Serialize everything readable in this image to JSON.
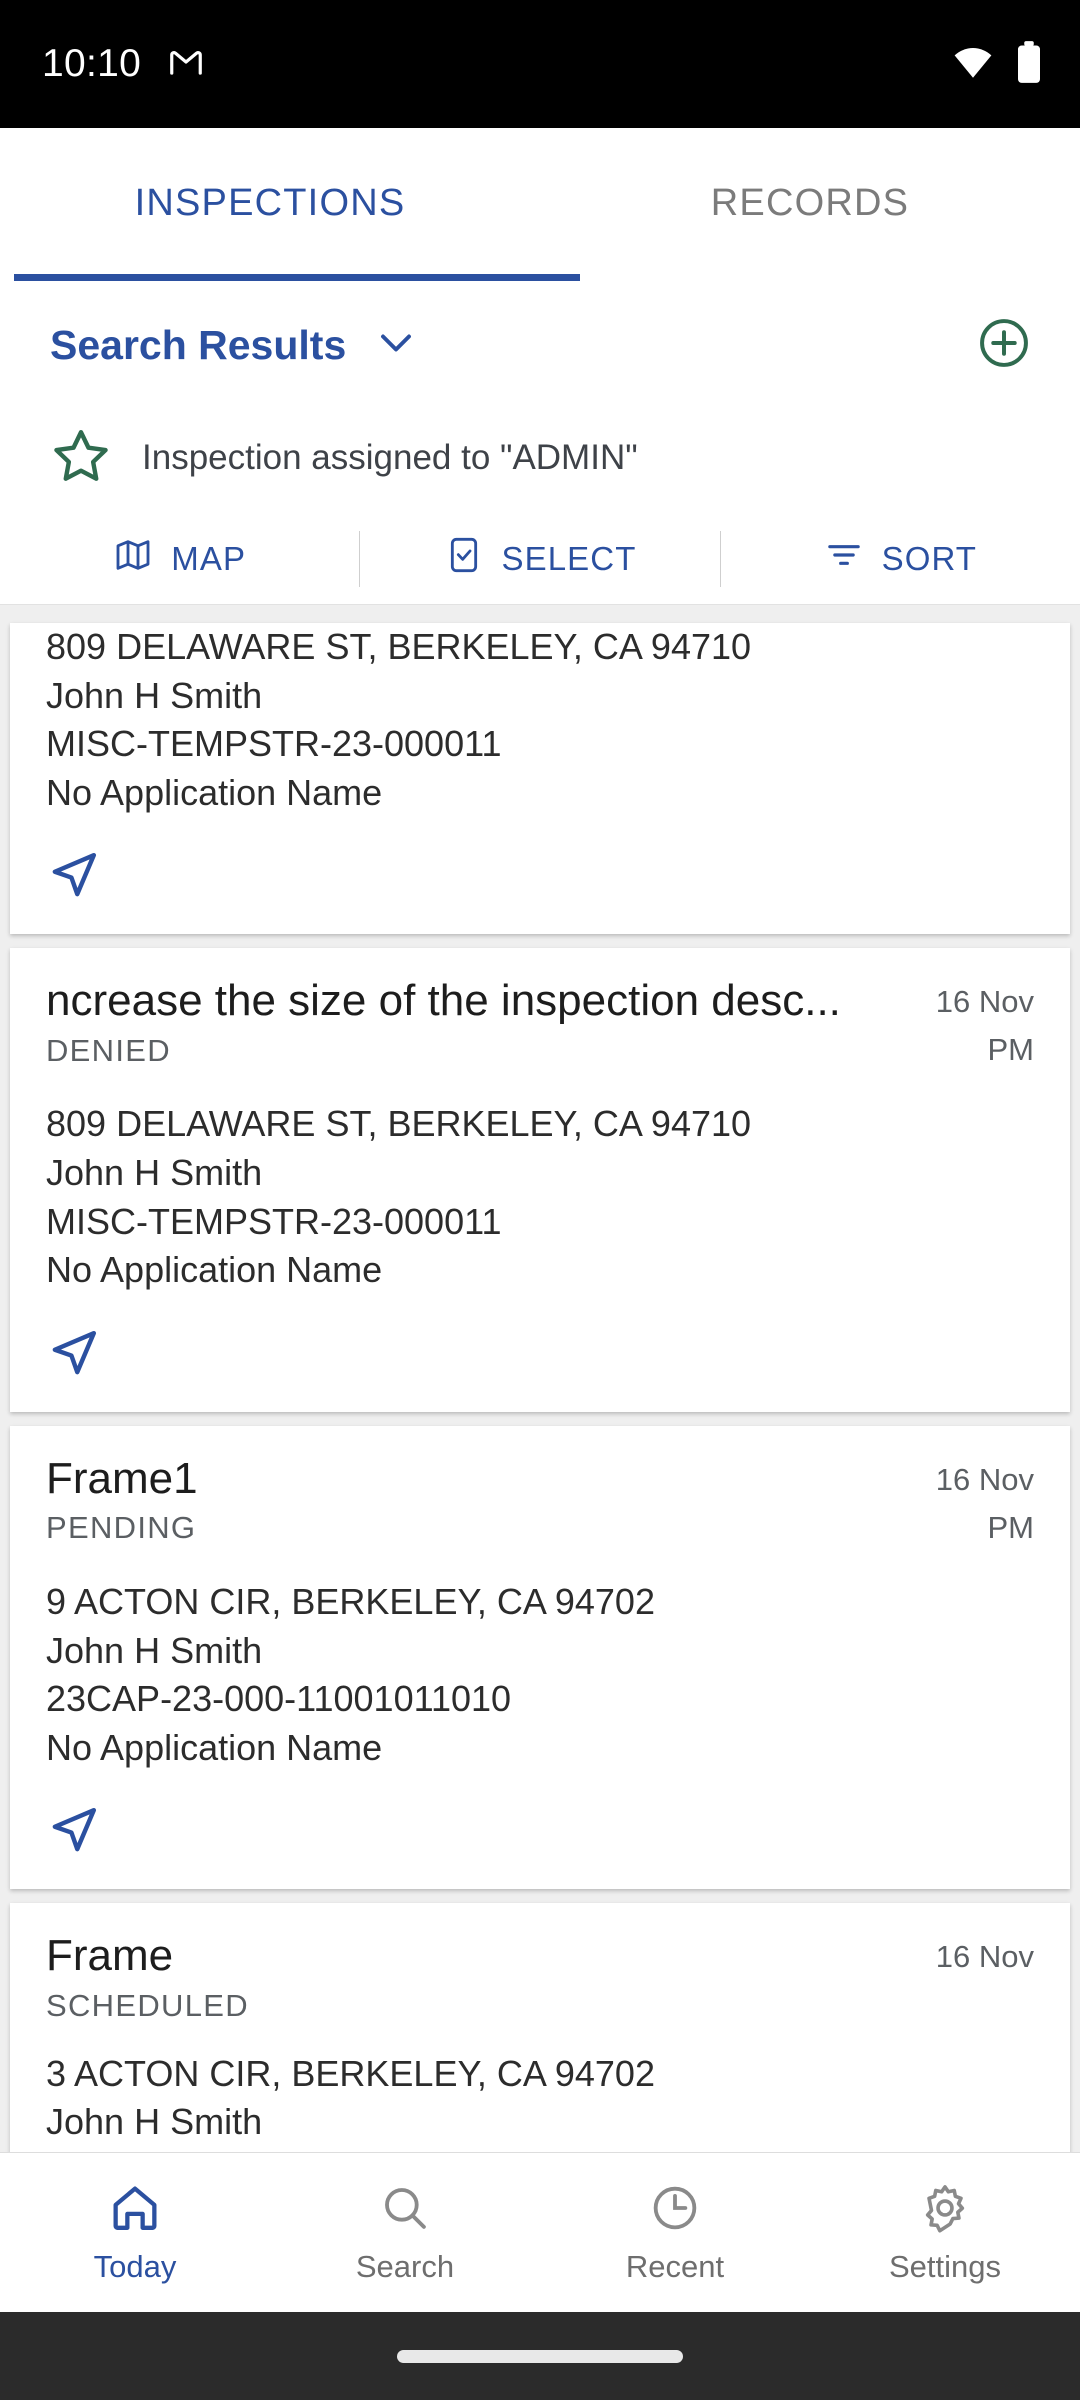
{
  "status_bar": {
    "time": "10:10",
    "icons": [
      "gmail-m-icon",
      "wifi-icon",
      "battery-icon"
    ]
  },
  "tabs": [
    {
      "label": "INSPECTIONS",
      "active": true
    },
    {
      "label": "RECORDS",
      "active": false
    }
  ],
  "results_header": {
    "title": "Search Results",
    "dropdown_icon": "chevron-down-icon",
    "add_icon": "plus-circle-icon"
  },
  "assigned_banner": {
    "icon": "star-outline-icon",
    "text": "Inspection assigned to \"ADMIN\""
  },
  "toolbar": {
    "map_label": "MAP",
    "select_label": "SELECT",
    "sort_label": "SORT"
  },
  "cards": [
    {
      "clipped": true,
      "title": "",
      "status": "",
      "date": "",
      "time": "",
      "address": "809 DELAWARE ST, BERKELEY, CA 94710",
      "contact": "John H Smith",
      "record": "MISC-TEMPSTR-23-000011",
      "application": "No Application Name"
    },
    {
      "clipped": false,
      "title": "ncrease the size of the inspection desc...",
      "status": "DENIED",
      "date": "16 Nov",
      "time": "PM",
      "address": "809 DELAWARE ST, BERKELEY, CA 94710",
      "contact": "John H Smith",
      "record": "MISC-TEMPSTR-23-000011",
      "application": "No Application Name"
    },
    {
      "clipped": false,
      "title": "Frame1",
      "status": "PENDING",
      "date": "16 Nov",
      "time": "PM",
      "address": "9 ACTON CIR, BERKELEY, CA 94702",
      "contact": "John H Smith",
      "record": "23CAP-23-000-11001011010",
      "application": "No Application Name"
    },
    {
      "clipped": false,
      "title": "Frame",
      "status": "SCHEDULED",
      "date": "16 Nov",
      "time": "",
      "address": "3 ACTON CIR, BERKELEY, CA 94702",
      "contact": "John H Smith",
      "record": "",
      "application": ""
    }
  ],
  "bottom_nav": [
    {
      "label": "Today",
      "icon": "home-icon",
      "active": true
    },
    {
      "label": "Search",
      "icon": "search-icon",
      "active": false
    },
    {
      "label": "Recent",
      "icon": "clock-icon",
      "active": false
    },
    {
      "label": "Settings",
      "icon": "gear-icon",
      "active": false
    }
  ],
  "colors": {
    "accent_blue": "#2B50A0",
    "accent_green": "#2F6B4F",
    "text_dark": "#1d1d1d",
    "text_muted": "#5b5f63",
    "list_bg": "#efefef"
  }
}
